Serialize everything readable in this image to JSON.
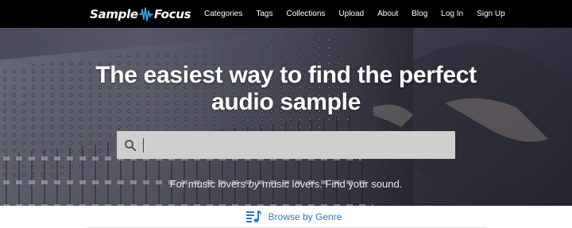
{
  "header": {
    "logo_part1": "Sample",
    "logo_part2": "Focus",
    "nav": [
      "Categories",
      "Tags",
      "Collections",
      "Upload",
      "About",
      "Blog",
      "Log In",
      "Sign Up"
    ]
  },
  "hero": {
    "title_line1": "The easiest way to find the perfect",
    "title_line2": "audio sample",
    "search_placeholder": "",
    "tagline_pre": "For music lovers ",
    "tagline_em": "by",
    "tagline_post": " music lovers. Find your sound."
  },
  "browse": {
    "label": "Browse by Genre"
  },
  "colors": {
    "nav_bg": "#000000",
    "accent_blue": "#2b7bbf",
    "search_bg": "#cfcfcf"
  }
}
